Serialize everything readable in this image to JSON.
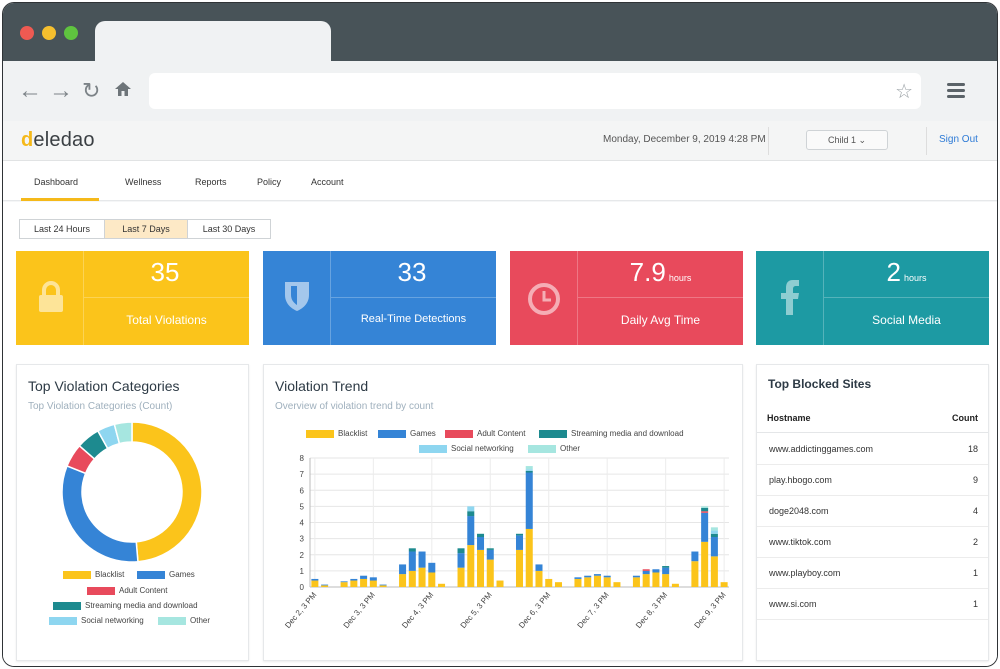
{
  "header": {
    "logo_text": "eledao",
    "logo_initial": "d",
    "datetime": "Monday, December 9, 2019 4:28 PM",
    "child_select": "Child 1",
    "sign_out": "Sign Out"
  },
  "nav": {
    "tabs": [
      {
        "label": "Dashboard"
      },
      {
        "label": "Wellness"
      },
      {
        "label": "Reports"
      },
      {
        "label": "Policy"
      },
      {
        "label": "Account"
      }
    ]
  },
  "ranges": [
    {
      "label": "Last 24 Hours"
    },
    {
      "label": "Last 7 Days"
    },
    {
      "label": "Last 30 Days"
    }
  ],
  "kpis": [
    {
      "value": "35",
      "unit": "",
      "label": "Total Violations",
      "color": "#fbc41b",
      "icon": "lock-icon"
    },
    {
      "value": "33",
      "unit": "",
      "label": "Real-Time Detections",
      "color": "#3584d6",
      "icon": "shield-icon"
    },
    {
      "value": "7.9",
      "unit": "hours",
      "label": "Daily Avg Time",
      "color": "#e84a5c",
      "icon": "clock-icon"
    },
    {
      "value": "2",
      "unit": "hours",
      "label": "Social Media",
      "color": "#1d9aa3",
      "icon": "facebook-icon"
    }
  ],
  "categories_card": {
    "title": "Top Violation Categories",
    "subtitle": "Top Violation Categories (Count)"
  },
  "trend_card": {
    "title": "Violation Trend",
    "subtitle": "Overview of violation trend by count"
  },
  "sites_card": {
    "title": "Top Blocked Sites",
    "col_host": "Hostname",
    "col_count": "Count",
    "rows": [
      {
        "host": "www.addictinggames.com",
        "count": "18"
      },
      {
        "host": "play.hbogo.com",
        "count": "9"
      },
      {
        "host": "doge2048.com",
        "count": "4"
      },
      {
        "host": "www.tiktok.com",
        "count": "2"
      },
      {
        "host": "www.playboy.com",
        "count": "1"
      },
      {
        "host": "www.si.com",
        "count": "1"
      }
    ]
  },
  "chart_data": [
    {
      "type": "pie",
      "variant": "doughnut",
      "labels": [
        "Blacklist",
        "Games",
        "Adult Content",
        "Streaming media and download",
        "Social networking",
        "Other"
      ],
      "values": [
        18,
        12,
        2,
        2,
        1.5,
        1.5
      ],
      "colors": [
        "#fbc41b",
        "#3584d6",
        "#e84a5c",
        "#1d8a8f",
        "#8ed6f0",
        "#a6e6e0"
      ],
      "legend_position": "bottom"
    },
    {
      "type": "bar",
      "stacked": true,
      "x_ticks": [
        "Dec 2, 3 PM",
        "Dec 3, 3 PM",
        "Dec 4, 3 PM",
        "Dec 5, 3 PM",
        "Dec 6, 3 PM",
        "Dec 7, 3 PM",
        "Dec 8, 3 PM",
        "Dec 9, 3 PM"
      ],
      "ylim": [
        0,
        8
      ],
      "y_ticks": [
        0,
        1,
        2,
        3,
        4,
        5,
        6,
        7,
        8
      ],
      "grid": true,
      "legend_position": "top",
      "series": [
        {
          "name": "Blacklist",
          "color": "#fbc41b",
          "values": [
            0.4,
            0.1,
            0,
            0.3,
            0.4,
            0.5,
            0.4,
            0.1,
            0,
            0.8,
            1.0,
            1.2,
            0.9,
            0.2,
            0,
            1.2,
            2.6,
            2.3,
            1.7,
            0.4,
            0,
            2.3,
            3.6,
            1.0,
            0.5,
            0.3,
            0,
            0.5,
            0.6,
            0.7,
            0.6,
            0.3,
            0,
            0.6,
            0.8,
            0.9,
            0.8,
            0.2,
            0,
            1.6,
            2.8,
            1.9,
            0.3
          ]
        },
        {
          "name": "Games",
          "color": "#3584d6",
          "values": [
            0.1,
            0.05,
            0,
            0.05,
            0.1,
            0.2,
            0.2,
            0.05,
            0,
            0.6,
            1.2,
            1.0,
            0.6,
            0,
            0,
            0.9,
            1.8,
            0.8,
            0.6,
            0,
            0,
            0.9,
            3.5,
            0.4,
            0,
            0,
            0,
            0.1,
            0.1,
            0.1,
            0.1,
            0,
            0,
            0.1,
            0.2,
            0.2,
            0.4,
            0,
            0,
            0.6,
            1.8,
            1.2,
            0
          ]
        },
        {
          "name": "Adult Content",
          "color": "#e84a5c",
          "values": [
            0,
            0,
            0,
            0,
            0,
            0,
            0,
            0,
            0,
            0,
            0,
            0,
            0,
            0,
            0,
            0,
            0,
            0,
            0,
            0,
            0,
            0,
            0,
            0,
            0,
            0,
            0,
            0,
            0,
            0,
            0,
            0,
            0,
            0,
            0.1,
            0,
            0,
            0,
            0,
            0,
            0.1,
            0,
            0
          ]
        },
        {
          "name": "Streaming media and download",
          "color": "#1d8a8f",
          "values": [
            0,
            0,
            0,
            0,
            0,
            0,
            0,
            0,
            0,
            0,
            0.2,
            0,
            0,
            0,
            0,
            0.3,
            0.3,
            0.2,
            0.1,
            0,
            0,
            0.1,
            0.1,
            0,
            0,
            0,
            0,
            0,
            0,
            0,
            0,
            0,
            0,
            0,
            0,
            0,
            0.1,
            0,
            0,
            0,
            0.2,
            0.2,
            0
          ]
        },
        {
          "name": "Social networking",
          "color": "#8ed6f0",
          "values": [
            0,
            0,
            0,
            0,
            0,
            0,
            0,
            0,
            0,
            0,
            0,
            0,
            0,
            0,
            0,
            0,
            0.3,
            0,
            0,
            0,
            0,
            0,
            0.1,
            0,
            0,
            0,
            0,
            0,
            0,
            0,
            0,
            0,
            0,
            0,
            0,
            0,
            0,
            0,
            0,
            0,
            0,
            0.2,
            0
          ]
        },
        {
          "name": "Other",
          "color": "#a6e6e0",
          "values": [
            0,
            0,
            0,
            0,
            0,
            0,
            0,
            0,
            0,
            0,
            0,
            0,
            0,
            0,
            0,
            0,
            0,
            0,
            0,
            0,
            0,
            0,
            0.2,
            0,
            0,
            0,
            0,
            0,
            0,
            0,
            0,
            0,
            0,
            0,
            0,
            0,
            0,
            0,
            0,
            0,
            0.1,
            0.2,
            0
          ]
        }
      ]
    }
  ]
}
